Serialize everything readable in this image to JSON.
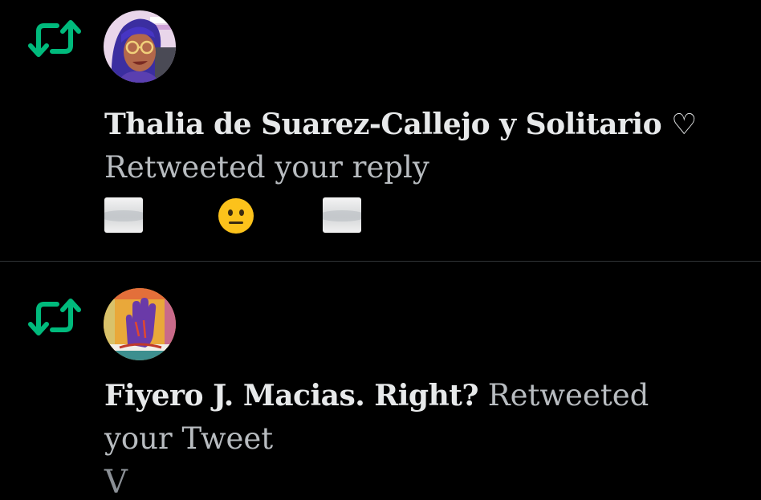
{
  "notifications": [
    {
      "type": "retweet",
      "icon": "retweet-icon",
      "avatar": "avatar-illustrated-woman-with-glasses",
      "name": "Thalia de Suarez-Callejo y Solitario ♡",
      "action": "Retweeted your reply",
      "content_emojis": [
        "cloud-icon",
        "neutral-face-icon",
        "cloud-icon"
      ]
    },
    {
      "type": "retweet",
      "icon": "retweet-icon",
      "avatar": "avatar-raised-hand",
      "name": "Fiyero J. Macias. Right?",
      "action_line1": "Retweeted",
      "action_line2": "your Tweet",
      "snippet": "V"
    }
  ],
  "colors": {
    "background": "#000000",
    "retweet_green": "#00ba7c",
    "divider": "#2f3336",
    "text_primary": "#e7e9ea",
    "text_secondary": "#8b9096"
  }
}
